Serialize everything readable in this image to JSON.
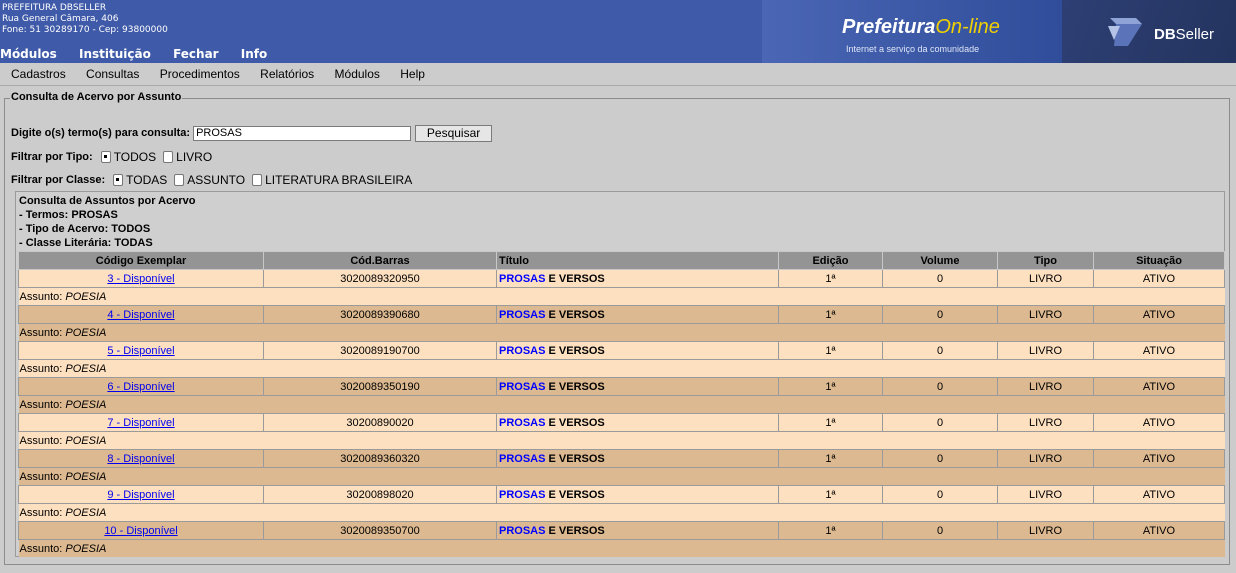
{
  "header": {
    "org_lines": [
      "PREFEITURA DBSELLER",
      "Rua General Câmara, 406",
      "Fone: 51 30289170  -  Cep: 93800000"
    ],
    "top_menu": [
      "Módulos",
      "Instituição",
      "Fechar",
      "Info"
    ],
    "brand_prefix": "Prefeitura",
    "brand_suffix": "On-line",
    "brand_tagline": "Internet a serviço da comunidade",
    "vendor_bold": "DB",
    "vendor_rest": "Seller"
  },
  "menubar": [
    "Cadastros",
    "Consultas",
    "Procedimentos",
    "Relatórios",
    "Módulos",
    "Help"
  ],
  "form": {
    "legend": "Consulta de Acervo por Assunto",
    "search_label": "Digite o(s) termo(s) para consulta:",
    "search_value": "PROSAS",
    "search_button": "Pesquisar",
    "tipo_label": "Filtrar por Tipo:",
    "tipo_options": [
      {
        "label": "TODOS",
        "checked": true
      },
      {
        "label": "LIVRO",
        "checked": false
      }
    ],
    "classe_label": "Filtrar por Classe:",
    "classe_options": [
      {
        "label": "TODAS",
        "checked": true
      },
      {
        "label": "ASSUNTO",
        "checked": false
      },
      {
        "label": "LITERATURA BRASILEIRA",
        "checked": false
      }
    ]
  },
  "summary": [
    "Consulta de Assuntos por Acervo",
    "- Termos: PROSAS",
    "- Tipo de Acervo: TODOS",
    "- Classe Literária: TODAS"
  ],
  "table": {
    "columns": [
      "Código Exemplar",
      "Cód.Barras",
      "Título",
      "Edição",
      "Volume",
      "Tipo",
      "Situação"
    ],
    "assunto_prefix": "Assunto:",
    "rows": [
      {
        "code": "3 - Disponível",
        "barcode": "3020089320950",
        "title_hl": "PROSAS",
        "title_rest": " E VERSOS",
        "edicao": "1ª",
        "volume": "0",
        "tipo": "LIVRO",
        "situacao": "ATIVO",
        "assunto": "POESIA"
      },
      {
        "code": "4 - Disponível",
        "barcode": "3020089390680",
        "title_hl": "PROSAS",
        "title_rest": " E VERSOS",
        "edicao": "1ª",
        "volume": "0",
        "tipo": "LIVRO",
        "situacao": "ATIVO",
        "assunto": "POESIA"
      },
      {
        "code": "5 - Disponível",
        "barcode": "3020089190700",
        "title_hl": "PROSAS",
        "title_rest": " E VERSOS",
        "edicao": "1ª",
        "volume": "0",
        "tipo": "LIVRO",
        "situacao": "ATIVO",
        "assunto": "POESIA"
      },
      {
        "code": "6 - Disponível",
        "barcode": "3020089350190",
        "title_hl": "PROSAS",
        "title_rest": " E VERSOS",
        "edicao": "1ª",
        "volume": "0",
        "tipo": "LIVRO",
        "situacao": "ATIVO",
        "assunto": "POESIA"
      },
      {
        "code": "7 - Disponível",
        "barcode": "30200890020",
        "title_hl": "PROSAS",
        "title_rest": " E VERSOS",
        "edicao": "1ª",
        "volume": "0",
        "tipo": "LIVRO",
        "situacao": "ATIVO",
        "assunto": "POESIA"
      },
      {
        "code": "8 - Disponível",
        "barcode": "3020089360320",
        "title_hl": "PROSAS",
        "title_rest": " E VERSOS",
        "edicao": "1ª",
        "volume": "0",
        "tipo": "LIVRO",
        "situacao": "ATIVO",
        "assunto": "POESIA"
      },
      {
        "code": "9 - Disponível",
        "barcode": "30200898020",
        "title_hl": "PROSAS",
        "title_rest": " E VERSOS",
        "edicao": "1ª",
        "volume": "0",
        "tipo": "LIVRO",
        "situacao": "ATIVO",
        "assunto": "POESIA"
      },
      {
        "code": "10 - Disponível",
        "barcode": "3020089350700",
        "title_hl": "PROSAS",
        "title_rest": " E VERSOS",
        "edicao": "1ª",
        "volume": "0",
        "tipo": "LIVRO",
        "situacao": "ATIVO",
        "assunto": "POESIA"
      }
    ]
  },
  "colors": {
    "header_bg": "#3f5aa8",
    "row_light": "#fde0c0",
    "row_dark": "#dcb990",
    "header_cell": "#949494",
    "highlight": "#0000ff"
  }
}
